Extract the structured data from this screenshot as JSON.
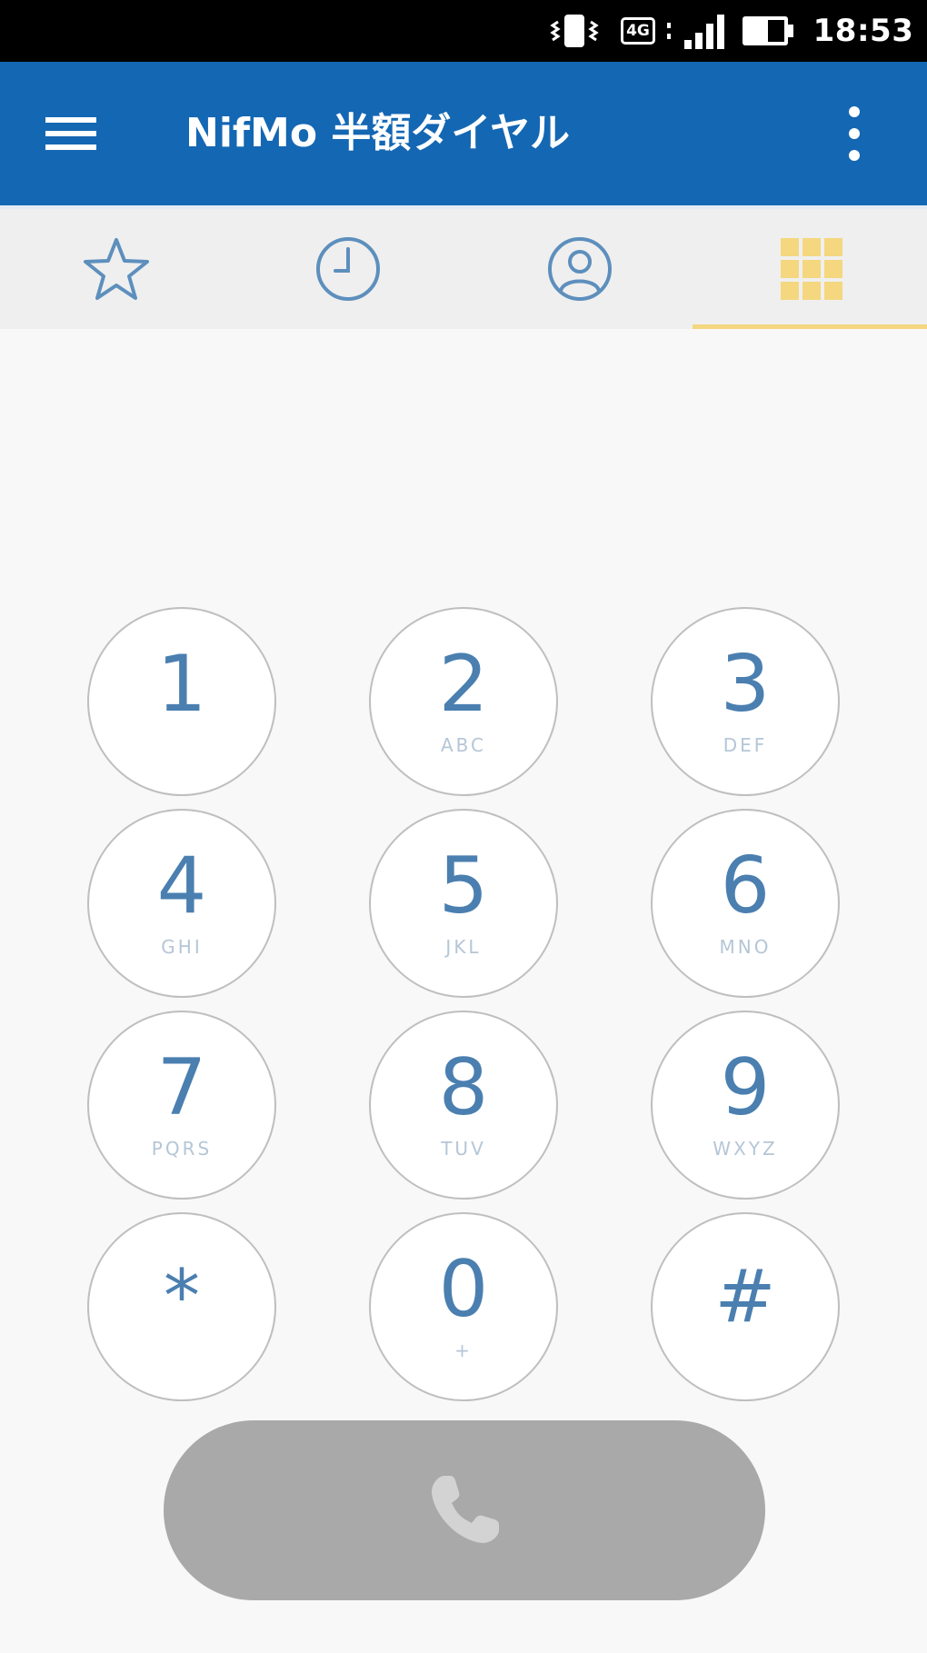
{
  "status_bar": {
    "network": "4G",
    "time": "18:53"
  },
  "app_bar": {
    "title": "NifMo 半額ダイヤル",
    "menu_icon": "hamburger-menu-icon",
    "overflow_icon": "more-vert-icon",
    "color": "#1467b3"
  },
  "tabs": [
    {
      "name": "favorites",
      "icon": "star-icon",
      "selected": false
    },
    {
      "name": "history",
      "icon": "clock-icon",
      "selected": false
    },
    {
      "name": "contacts",
      "icon": "person-icon",
      "selected": false
    },
    {
      "name": "keypad",
      "icon": "keypad-icon",
      "selected": true
    }
  ],
  "keypad": {
    "keys": [
      {
        "digit": "1",
        "letters": ""
      },
      {
        "digit": "2",
        "letters": "ABC"
      },
      {
        "digit": "3",
        "letters": "DEF"
      },
      {
        "digit": "4",
        "letters": "GHI"
      },
      {
        "digit": "5",
        "letters": "JKL"
      },
      {
        "digit": "6",
        "letters": "MNO"
      },
      {
        "digit": "7",
        "letters": "PQRS"
      },
      {
        "digit": "8",
        "letters": "TUV"
      },
      {
        "digit": "9",
        "letters": "WXYZ"
      },
      {
        "digit": "*",
        "letters": ""
      },
      {
        "digit": "0",
        "letters": "+"
      },
      {
        "digit": "#",
        "letters": ""
      }
    ],
    "digit_color": "#4a7fb0"
  },
  "call_button": {
    "icon": "phone-handset-icon",
    "enabled": false,
    "color": "#a9a9a9"
  },
  "accent_colors": {
    "tab_indicator": "#f4d77f",
    "tab_icon": "#5d8fbd"
  }
}
